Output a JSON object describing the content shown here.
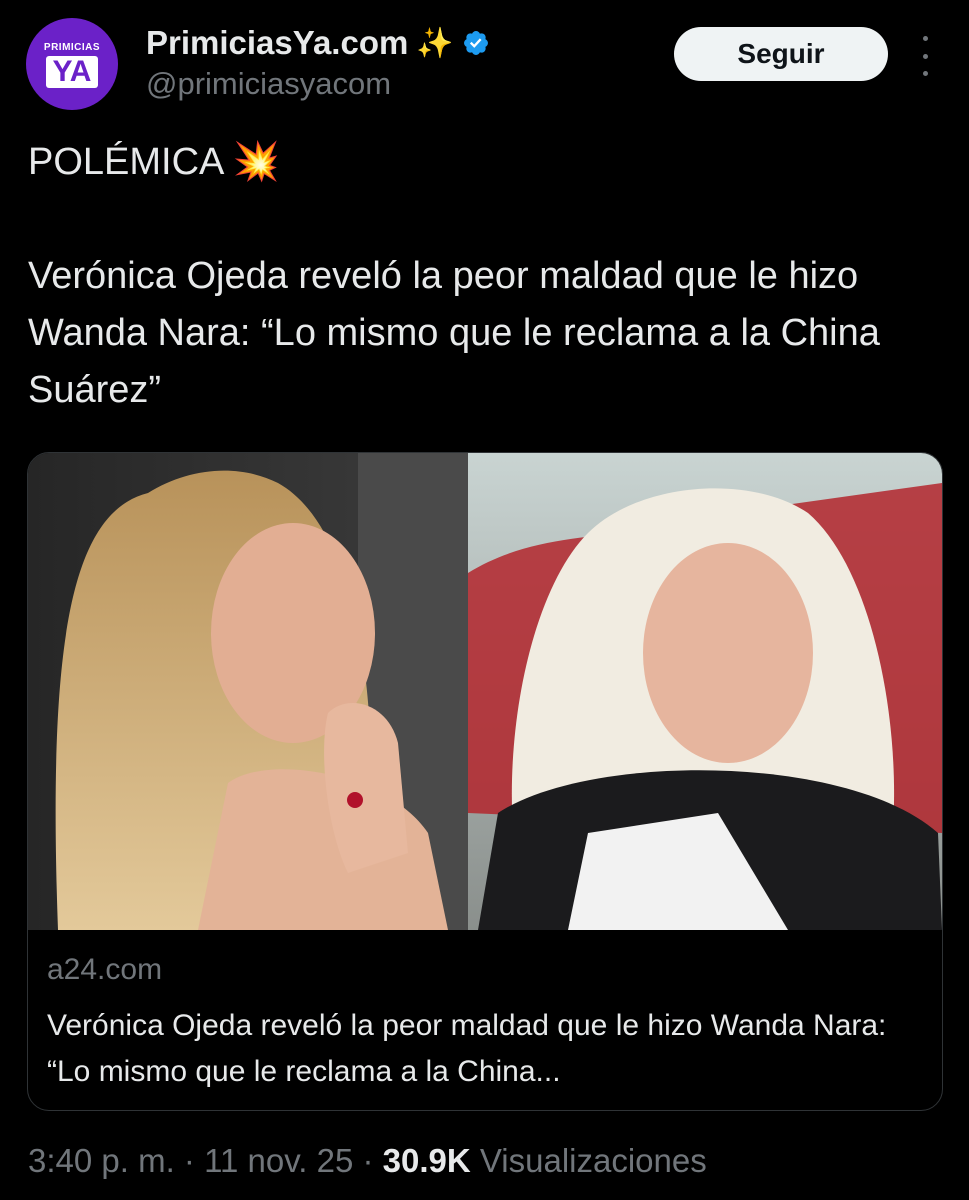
{
  "account": {
    "avatar_small_text": "PRIMICIAS",
    "avatar_big_text": "YA",
    "name": "PrimiciasYa.com",
    "name_emoji": "✨",
    "handle": "@primiciasyacom",
    "follow_label": "Seguir"
  },
  "tweet": {
    "line1": "POLÉMICA 💥",
    "body": "Verónica Ojeda reveló la peor maldad que le hizo Wanda Nara: “Lo mismo que le reclama a la China Suárez”"
  },
  "card": {
    "domain": "a24.com",
    "title": "Verónica Ojeda reveló la peor maldad que le hizo Wanda Nara: “Lo mismo que le reclama a la China..."
  },
  "meta": {
    "time": "3:40 p. m.",
    "sep1": " · ",
    "date": "11 nov. 25",
    "sep2": " · ",
    "views_count": "30.9K",
    "views_label": " Visualizaciones"
  },
  "colors": {
    "background": "#000000",
    "text": "#e7e9ea",
    "muted": "#71767b",
    "avatar": "#6b21c8",
    "verified": "#1d9bf0"
  }
}
